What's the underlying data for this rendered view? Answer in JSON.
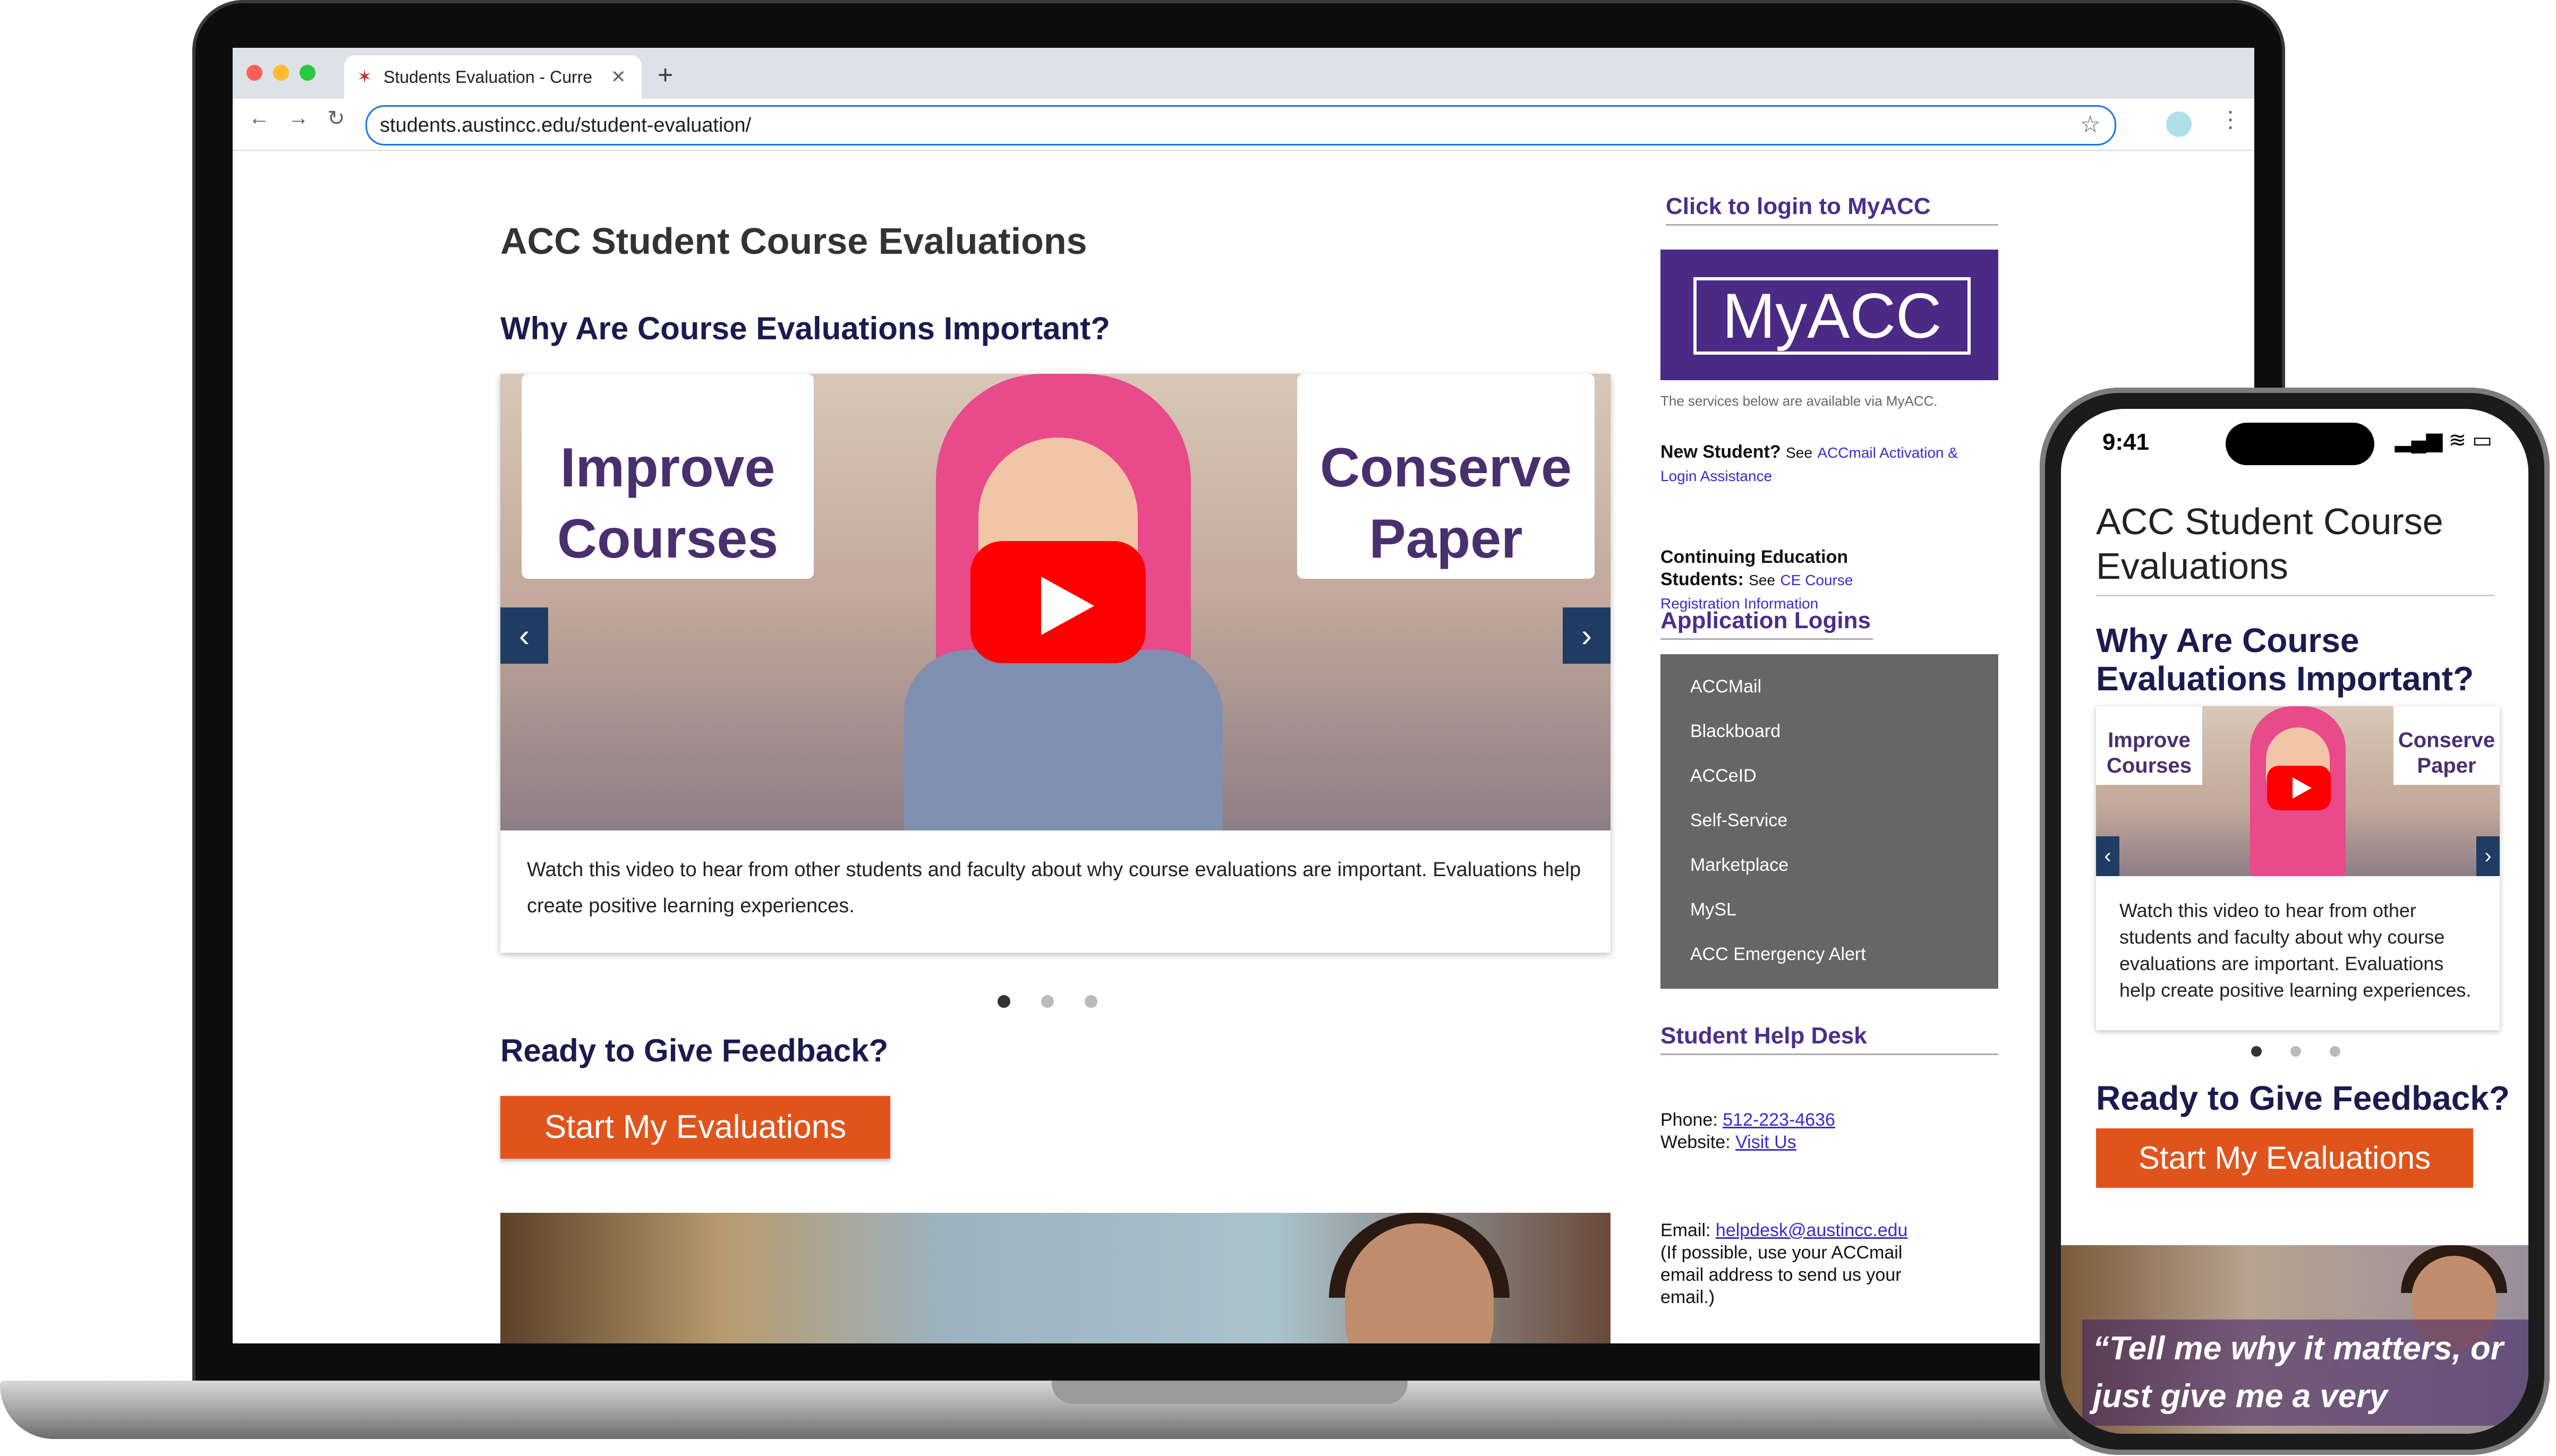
{
  "browser": {
    "tab_title": "Students Evaluation - Curre",
    "new_tab_label": "+",
    "url": "students.austincc.edu/student-evaluation/"
  },
  "page": {
    "title": "ACC Student Course Evaluations",
    "why_heading": "Why Are Course Evaluations Important?",
    "video": {
      "card_left_line1": "Improve",
      "card_left_line2": "Courses",
      "card_right_line1": "Conserve",
      "card_right_line2": "Paper"
    },
    "caption": "Watch this video to hear from other students and faculty about why course evaluations are important. Evaluations help create positive learning experiences.",
    "feedback_heading": "Ready to Give Feedback?",
    "start_button": "Start My Evaluations"
  },
  "sidebar": {
    "login_heading": "Click to login to MyACC",
    "logo_text": "MyACC",
    "services_note": "The services below are available via MyACC.",
    "new_student_label": "New Student?",
    "new_student_see": "See",
    "new_student_link": "ACCmail Activation & Login Assistance",
    "ce_label": "Continuing Education Students:",
    "ce_see": "See",
    "ce_link": "CE Course Registration Information",
    "app_heading": "Application Logins",
    "apps": [
      "ACCMail",
      "Blackboard",
      "ACCeID",
      "Self-Service",
      "Marketplace",
      "MySL",
      "ACC Emergency Alert"
    ],
    "help_heading": "Student Help Desk",
    "phone_label": "Phone:",
    "phone": "512-223-4636",
    "website_label": "Website:",
    "website_link": "Visit Us",
    "email_label": "Email:",
    "email": "helpdesk@austincc.edu",
    "email_note": "(If possible, use your ACCmail email address to send us your email.)"
  },
  "phone": {
    "time": "9:41",
    "title": "ACC Student Course Evaluations",
    "why_heading": "Why Are Course Evaluations Important?",
    "card_left_line1": "Improve",
    "card_left_line2": "Courses",
    "card_right_line1": "Conserve",
    "card_right_line2": "Paper",
    "caption": "Watch this video to hear from other students and faculty about why course evaluations are important. Evaluations help create positive learning experiences.",
    "feedback_heading": "Ready to Give Feedback?",
    "start_button": "Start My Evaluations",
    "quote": "“Tell me why it matters, or just give me a very"
  },
  "colors": {
    "accent_orange": "#e0541c",
    "heading_navy": "#1d1a4f",
    "brand_purple": "#4b2a86",
    "arrow_blue": "#1f3d63"
  }
}
